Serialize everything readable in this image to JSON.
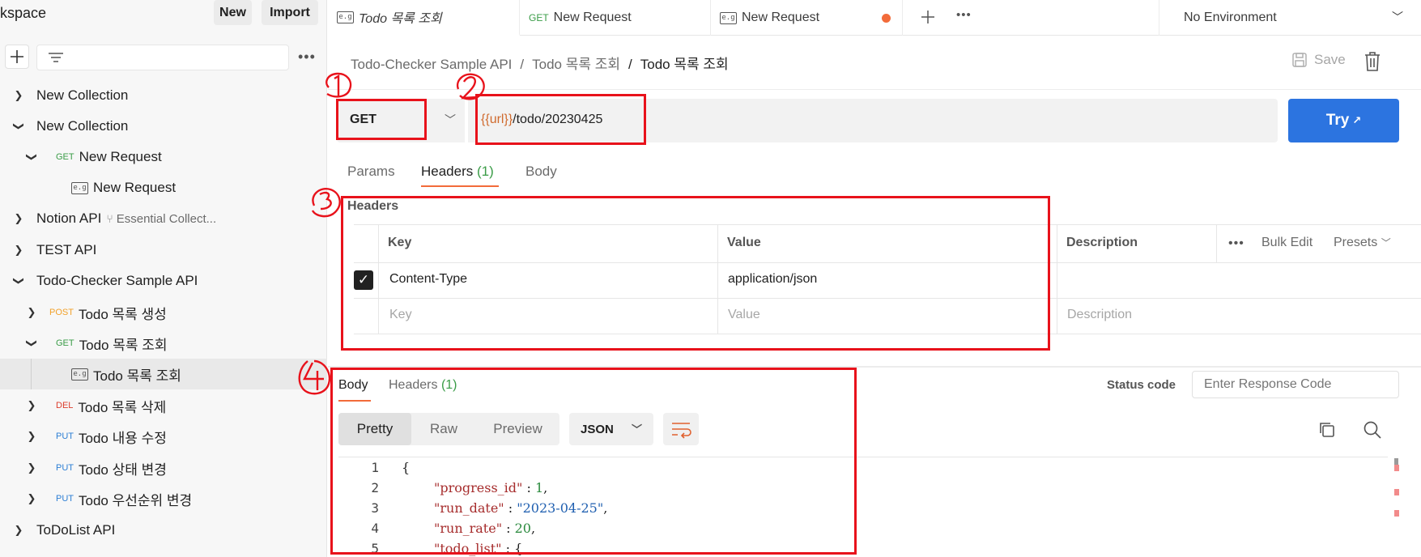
{
  "sidebar": {
    "workspace_title": "kspace",
    "new_label": "New",
    "import_label": "Import",
    "items": [
      {
        "label": "New Collection"
      },
      {
        "label": "New Collection"
      },
      {
        "method": "GET",
        "label": "New Request"
      },
      {
        "label": "New Request"
      },
      {
        "label": "Notion API",
        "sub": "Essential Collect..."
      },
      {
        "label": "TEST API"
      },
      {
        "label": "Todo-Checker Sample API"
      },
      {
        "method": "POST",
        "label": "Todo 목록 생성"
      },
      {
        "method": "GET",
        "label": "Todo 목록 조회"
      },
      {
        "label": "Todo 목록 조회"
      },
      {
        "method": "DEL",
        "label": "Todo 목록 삭제"
      },
      {
        "method": "PUT",
        "label": "Todo 내용 수정"
      },
      {
        "method": "PUT",
        "label": "Todo 상태 변경"
      },
      {
        "method": "PUT",
        "label": "Todo 우선순위 변경"
      },
      {
        "label": "ToDoList API"
      }
    ]
  },
  "tabs": [
    {
      "label": "Todo 목록 조회",
      "icon": "example-icon"
    },
    {
      "method": "GET",
      "label": "New Request"
    },
    {
      "label": "New Request",
      "icon": "example-icon"
    }
  ],
  "environment": "No Environment",
  "breadcrumb": [
    "Todo-Checker Sample API",
    "Todo 목록 조회",
    "Todo 목록 조회"
  ],
  "save_label": "Save",
  "request": {
    "method": "GET",
    "url_var": "{{url}}",
    "url_path": "/todo/20230425",
    "try_label": "Try",
    "try_arrow": "↗",
    "tabs": {
      "params": "Params",
      "headers": "Headers",
      "headers_count": "(1)",
      "body": "Body"
    }
  },
  "headers_table": {
    "title": "Headers",
    "col_key": "Key",
    "col_value": "Value",
    "col_description": "Description",
    "bulk_edit": "Bulk Edit",
    "presets": "Presets",
    "rows": [
      {
        "key": "Content-Type",
        "value": "application/json",
        "checked": true
      }
    ],
    "placeholder_key": "Key",
    "placeholder_value": "Value",
    "placeholder_description": "Description"
  },
  "response": {
    "tab_body": "Body",
    "tab_headers": "Headers",
    "headers_count": "(1)",
    "status_label": "Status code",
    "status_placeholder": "Enter Response Code",
    "modes": [
      "Pretty",
      "Raw",
      "Preview"
    ],
    "format": "JSON",
    "lines": [
      {
        "no": "1",
        "text": "{"
      },
      {
        "no": "2",
        "key": "\"progress_id\"",
        "sep": " : ",
        "val": "1",
        "type": "n",
        "end": ","
      },
      {
        "no": "3",
        "key": "\"run_date\"",
        "sep": " : ",
        "val": "\"2023-04-25\"",
        "type": "s",
        "end": ","
      },
      {
        "no": "4",
        "key": "\"run_rate\"",
        "sep": " : ",
        "val": "20",
        "type": "n",
        "end": ","
      },
      {
        "no": "5",
        "key": "\"todo_list\"",
        "sep": " : ",
        "val": "{",
        "type": "p",
        "end": ""
      }
    ]
  },
  "annotations": [
    "1",
    "2",
    "3",
    "4"
  ],
  "colors": {
    "accent": "#f26b3a",
    "primary": "#2c74e0",
    "annotation": "#e8121b",
    "get": "#3a9c47",
    "post": "#f2a12a",
    "del": "#dc3e2e",
    "put": "#2d7fd4"
  }
}
